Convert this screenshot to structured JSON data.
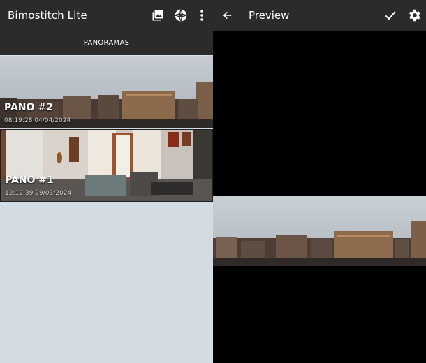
{
  "app": {
    "title": "Bimostitch Lite"
  },
  "toolbar": {
    "gallery_icon": "gallery-icon",
    "shutter_icon": "aperture-icon",
    "more_icon": "more-vert-icon"
  },
  "tabs": [
    {
      "label": "PANORAMAS"
    }
  ],
  "panoramas": [
    {
      "name": "PANO #2",
      "timestamp": "08:19:28 04/04/2024"
    },
    {
      "name": "PANO #1",
      "timestamp": "12:12:39 29/03/2024"
    }
  ],
  "preview": {
    "title": "Preview",
    "back_icon": "arrow-back-icon",
    "confirm_icon": "check-icon",
    "settings_icon": "gear-icon"
  },
  "colors": {
    "bar": "#2b2b2b",
    "list_background": "#d3dce2",
    "preview_background": "#000000"
  }
}
